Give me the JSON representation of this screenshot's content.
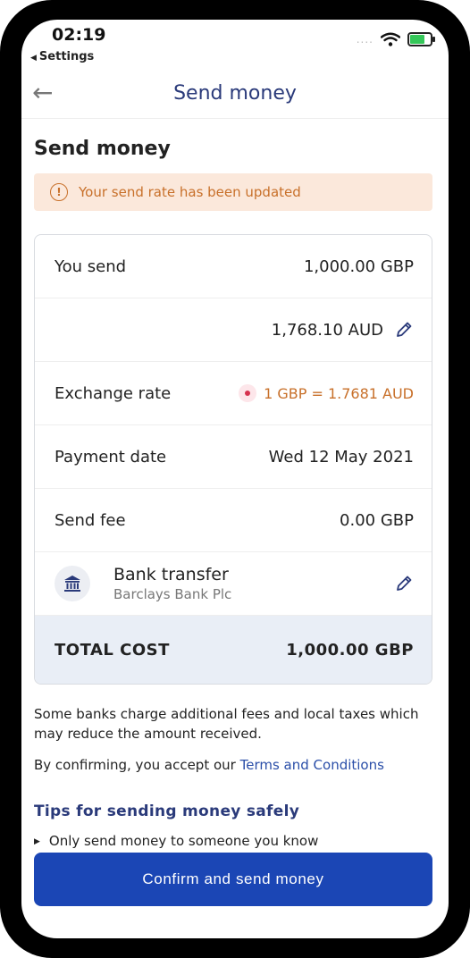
{
  "status_bar": {
    "time": "02:19",
    "back_app": "Settings",
    "back_triangle": "◀",
    "signal_dots": "....",
    "icons": [
      "wifi-icon",
      "battery-charging-icon"
    ]
  },
  "nav": {
    "back_icon": "←",
    "title": "Send money"
  },
  "page_heading": "Send money",
  "alert": {
    "icon": "!",
    "text": "Your send rate has been updated",
    "color": "#c8702a"
  },
  "summary": {
    "you_send_label": "You send",
    "you_send_value": "1,000.00 GBP",
    "receive_value": "1,768.10 AUD",
    "exchange_rate_label": "Exchange rate",
    "exchange_rate_value": "1 GBP = 1.7681 AUD",
    "payment_date_label": "Payment date",
    "payment_date_value": "Wed 12 May 2021",
    "send_fee_label": "Send fee",
    "send_fee_value": "0.00 GBP",
    "method_name": "Bank transfer",
    "method_bank": "Barclays Bank Plc",
    "total_label": "TOTAL COST",
    "total_value": "1,000.00 GBP"
  },
  "notes": {
    "fees": "Some banks charge additional fees and local taxes which may reduce the amount received.",
    "confirm_prefix": "By confirming, you accept our",
    "terms_link": "Terms and Conditions"
  },
  "tips": {
    "heading": "Tips for sending money safely",
    "bullet_marker": "▶",
    "first": "Only send money to someone you know"
  },
  "confirm_button": "Confirm and send money",
  "colors": {
    "brand_blue": "#1b46b5",
    "nav_title": "#2a3a7a",
    "link": "#2a4ea8",
    "alert_bg": "#fbe8db"
  }
}
